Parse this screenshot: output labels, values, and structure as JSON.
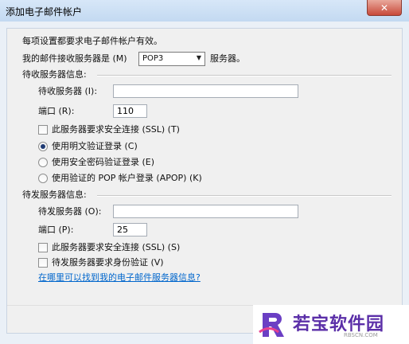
{
  "window": {
    "title": "添加电子邮件帐户",
    "close_glyph": "✕"
  },
  "intro": "每项设置都要求电子邮件帐户有效。",
  "server_type": {
    "label": "我的邮件接收服务器是 (M)",
    "selected": "POP3",
    "suffix": "服务器。"
  },
  "incoming": {
    "group_title": "待收服务器信息:",
    "server_label": "待收服务器 (I):",
    "server_value": "",
    "port_label": "端口 (R):",
    "port_value": "110",
    "ssl_label": "此服务器要求安全连接 (SSL) (T)",
    "auth_options": [
      {
        "label": "使用明文验证登录 (C)",
        "selected": true
      },
      {
        "label": "使用安全密码验证登录 (E)",
        "selected": false
      },
      {
        "label": "使用验证的 POP 帐户登录 (APOP) (K)",
        "selected": false
      }
    ]
  },
  "outgoing": {
    "group_title": "待发服务器信息:",
    "server_label": "待发服务器 (O):",
    "server_value": "",
    "port_label": "端口 (P):",
    "port_value": "25",
    "ssl_label": "此服务器要求安全连接 (SSL) (S)",
    "auth_label": "待发服务器要求身份验证 (V)"
  },
  "help_link": "在哪里可以找到我的电子邮件服务器信息?",
  "watermark": {
    "brand": "若宝软件园",
    "sub": "RBSCN.COM"
  },
  "colors": {
    "link": "#0066cc",
    "accent": "#5b2fa8",
    "close": "#c84a3a"
  }
}
